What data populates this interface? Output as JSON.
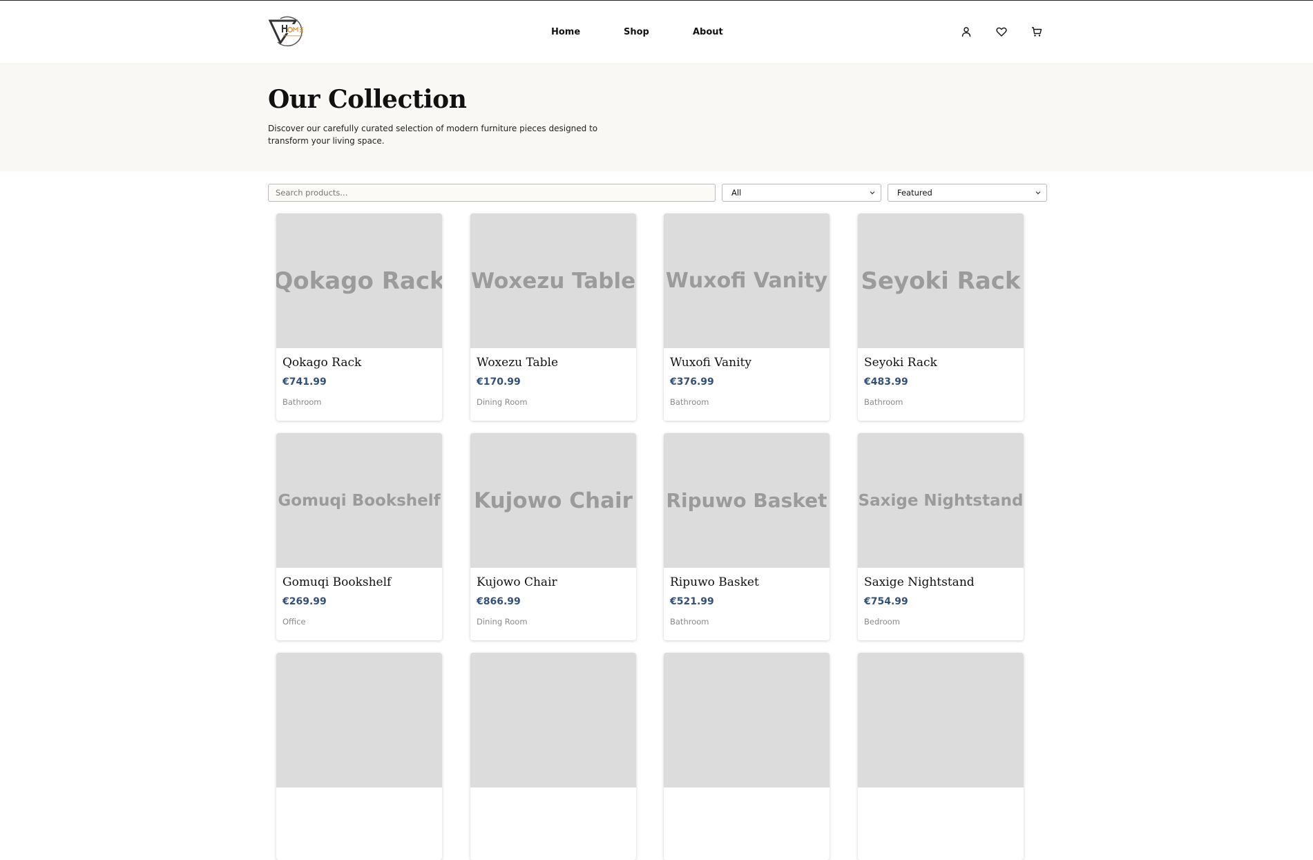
{
  "header": {
    "nav": [
      "Home",
      "Shop",
      "About"
    ],
    "icons": [
      "user-icon",
      "heart-icon",
      "cart-icon"
    ]
  },
  "hero": {
    "title": "Our Collection",
    "description": "Discover our carefully curated selection of modern furniture pieces designed to transform your living space."
  },
  "filters": {
    "search_placeholder": "Search products...",
    "category_selected": "All",
    "sort_selected": "Featured"
  },
  "products": [
    {
      "name": "Qokago Rack",
      "price": "€741.99",
      "category": "Bathroom"
    },
    {
      "name": "Woxezu Table",
      "price": "€170.99",
      "category": "Dining Room"
    },
    {
      "name": "Wuxofi Vanity",
      "price": "€376.99",
      "category": "Bathroom"
    },
    {
      "name": "Seyoki Rack",
      "price": "€483.99",
      "category": "Bathroom"
    },
    {
      "name": "Gomuqi Bookshelf",
      "price": "€269.99",
      "category": "Office"
    },
    {
      "name": "Kujowo Chair",
      "price": "€866.99",
      "category": "Dining Room"
    },
    {
      "name": "Ripuwo Basket",
      "price": "€521.99",
      "category": "Bathroom"
    },
    {
      "name": "Saxige Nightstand",
      "price": "€754.99",
      "category": "Bedroom"
    }
  ],
  "colors": {
    "hero_bg": "#f9f8f4",
    "price": "#33507a",
    "placeholder_bg": "#dcdcdc",
    "logo_accent": "#d9903a"
  }
}
